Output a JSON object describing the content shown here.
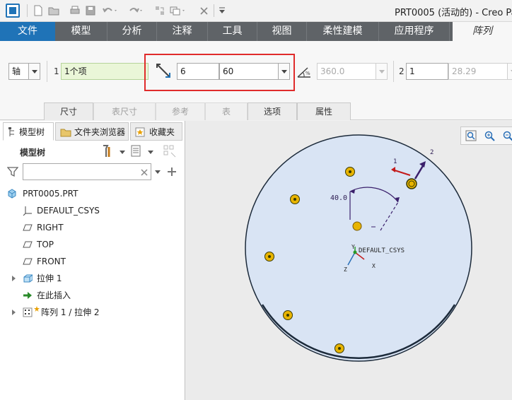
{
  "window": {
    "title": "PRT0005 (活动的) - Creo Pa"
  },
  "ribbon_tabs": [
    {
      "label": "文件"
    },
    {
      "label": "模型"
    },
    {
      "label": "分析"
    },
    {
      "label": "注释"
    },
    {
      "label": "工具"
    },
    {
      "label": "视图"
    },
    {
      "label": "柔性建模"
    },
    {
      "label": "应用程序"
    },
    {
      "label": "阵列"
    }
  ],
  "dashboard": {
    "pattern_type": "轴",
    "dir1_index": "1",
    "dir1_reference": "1个项",
    "member_count": "6",
    "angle_increment": "60",
    "angular_extent": "360.0",
    "dir2_index": "2",
    "dir2_count": "1",
    "dir2_spacing": "28.29"
  },
  "dashboard_tabs": [
    {
      "label": "尺寸",
      "enabled": true
    },
    {
      "label": "表尺寸",
      "enabled": false
    },
    {
      "label": "参考",
      "enabled": false
    },
    {
      "label": "表",
      "enabled": false
    },
    {
      "label": "选项",
      "enabled": true
    },
    {
      "label": "属性",
      "enabled": true
    }
  ],
  "panel_tabs": [
    {
      "label": "模型树"
    },
    {
      "label": "文件夹浏览器"
    },
    {
      "label": "收藏夹"
    }
  ],
  "model_tree": {
    "title": "模型树",
    "filter_placeholder": "",
    "items": [
      {
        "label": "PRT0005.PRT",
        "icon": "part-icon"
      },
      {
        "label": "DEFAULT_CSYS",
        "icon": "csys-icon"
      },
      {
        "label": "RIGHT",
        "icon": "datum-plane-icon"
      },
      {
        "label": "TOP",
        "icon": "datum-plane-icon"
      },
      {
        "label": "FRONT",
        "icon": "datum-plane-icon"
      },
      {
        "label": "拉伸 1",
        "icon": "extrude-icon"
      },
      {
        "label": "在此插入",
        "icon": "insert-arrow-icon"
      },
      {
        "label": "阵列 1 / 拉伸 2",
        "icon": "pattern-icon"
      }
    ]
  },
  "graphics": {
    "angle_dim": "40.0",
    "csys_label": "DEFAULT_CSYS",
    "axis_x": "X",
    "axis_y": "Y",
    "axis_z": "Z",
    "dir_label_1": "1",
    "dir_label_2": "2",
    "colors": {
      "disc": "#d9e4f4",
      "marker": "#e8b400",
      "dimension": "#3a1f6b",
      "dir1_arrow": "#c41a1a",
      "dir2_arrow": "#3a1f6b"
    }
  }
}
